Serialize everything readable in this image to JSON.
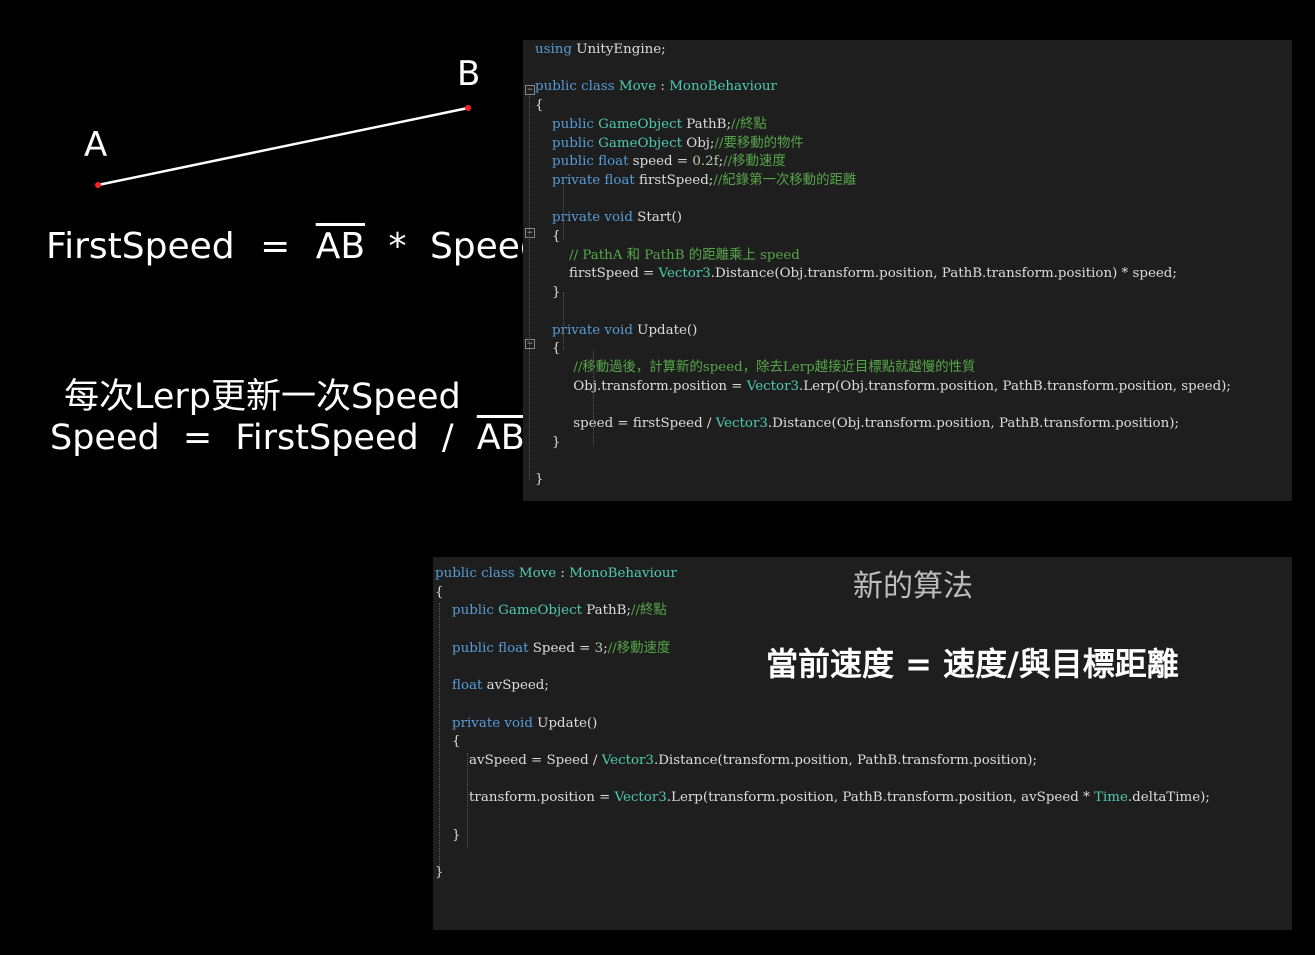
{
  "diagram": {
    "point_a": "A",
    "point_b": "B",
    "formula1": {
      "left": "FirstSpeed",
      "eq": "=",
      "ab": "AB",
      "op": "*",
      "right": "Speed"
    },
    "caption1": "每次Lerp更新一次Speed",
    "formula2": {
      "left": "Speed",
      "eq": "=",
      "mid": "FirstSpeed",
      "op": "/",
      "ab": "AB"
    },
    "colors": {
      "point": "#ff2020",
      "line": "#ffffff"
    }
  },
  "code1": {
    "lines": [
      "using UnityEngine;",
      "",
      "public class Move : MonoBehaviour",
      "{",
      "    public GameObject PathB;//終點",
      "    public GameObject Obj;//要移動的物件",
      "    public float speed = 0.2f;//移動速度",
      "    private float firstSpeed;//紀錄第一次移動的距離",
      "",
      "    private void Start()",
      "    {",
      "        // PathA 和 PathB 的距離乘上 speed",
      "        firstSpeed = Vector3.Distance(Obj.transform.position, PathB.transform.position) * speed;",
      "    }",
      "",
      "    private void Update()",
      "    {",
      "         //移動過後，計算新的speed，除去Lerp越接近目標點就越慢的性質",
      "         Obj.transform.position = Vector3.Lerp(Obj.transform.position, PathB.transform.position, speed);",
      "",
      "         speed = firstSpeed / Vector3.Distance(Obj.transform.position, PathB.transform.position);",
      "    }",
      "",
      "}"
    ]
  },
  "code2": {
    "lines": [
      "public class Move : MonoBehaviour",
      "{",
      "    public GameObject PathB;//終點",
      "",
      "    public float Speed = 3;//移動速度",
      "",
      "    float avSpeed;",
      "",
      "    private void Update()",
      "    {",
      "        avSpeed = Speed / Vector3.Distance(transform.position, PathB.transform.position);",
      "",
      "        transform.position = Vector3.Lerp(transform.position, PathB.transform.position, avSpeed * Time.deltaTime);",
      "",
      "    }",
      "",
      "}"
    ],
    "overlay_title": "新的算法",
    "overlay_formula": "當前速度 = 速度/與目標距離"
  },
  "colors": {
    "keyword": "#569cd6",
    "type": "#4ec9b0",
    "comment": "#57a64a",
    "number": "#b5cea8",
    "text": "#dcdcdc",
    "editor_bg": "#1e1e1e"
  }
}
